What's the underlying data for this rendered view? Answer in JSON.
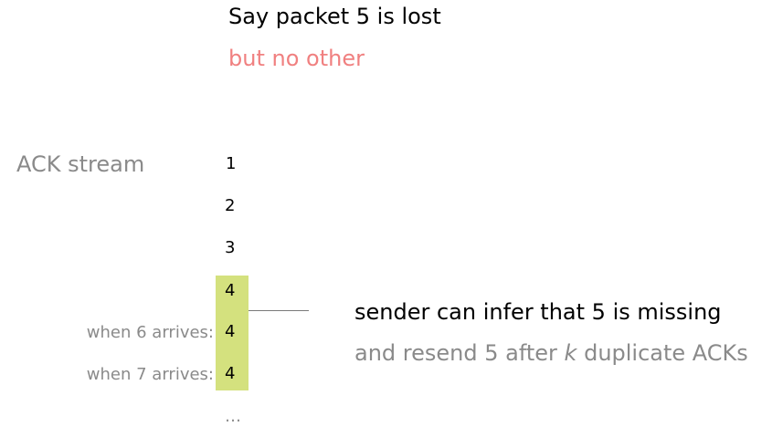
{
  "colors": {
    "accent": "#f08080",
    "highlight": "#d4e17e",
    "muted": "#8a8a8a",
    "text": "#000000",
    "connector": "#7a7a7a"
  },
  "title": "Say packet 5 is lost",
  "subtitle": "but no other",
  "stream_label": "ACK stream",
  "acks": [
    "1",
    "2",
    "3",
    "4",
    "4",
    "4"
  ],
  "ellipsis": "…",
  "arrivals": [
    "when 6 arrives:",
    "when 7 arrives:"
  ],
  "note": {
    "line1": "sender can infer that 5 is missing",
    "line2_before": "and resend 5 after ",
    "line2_k": "k",
    "line2_after": " duplicate ACKs"
  }
}
